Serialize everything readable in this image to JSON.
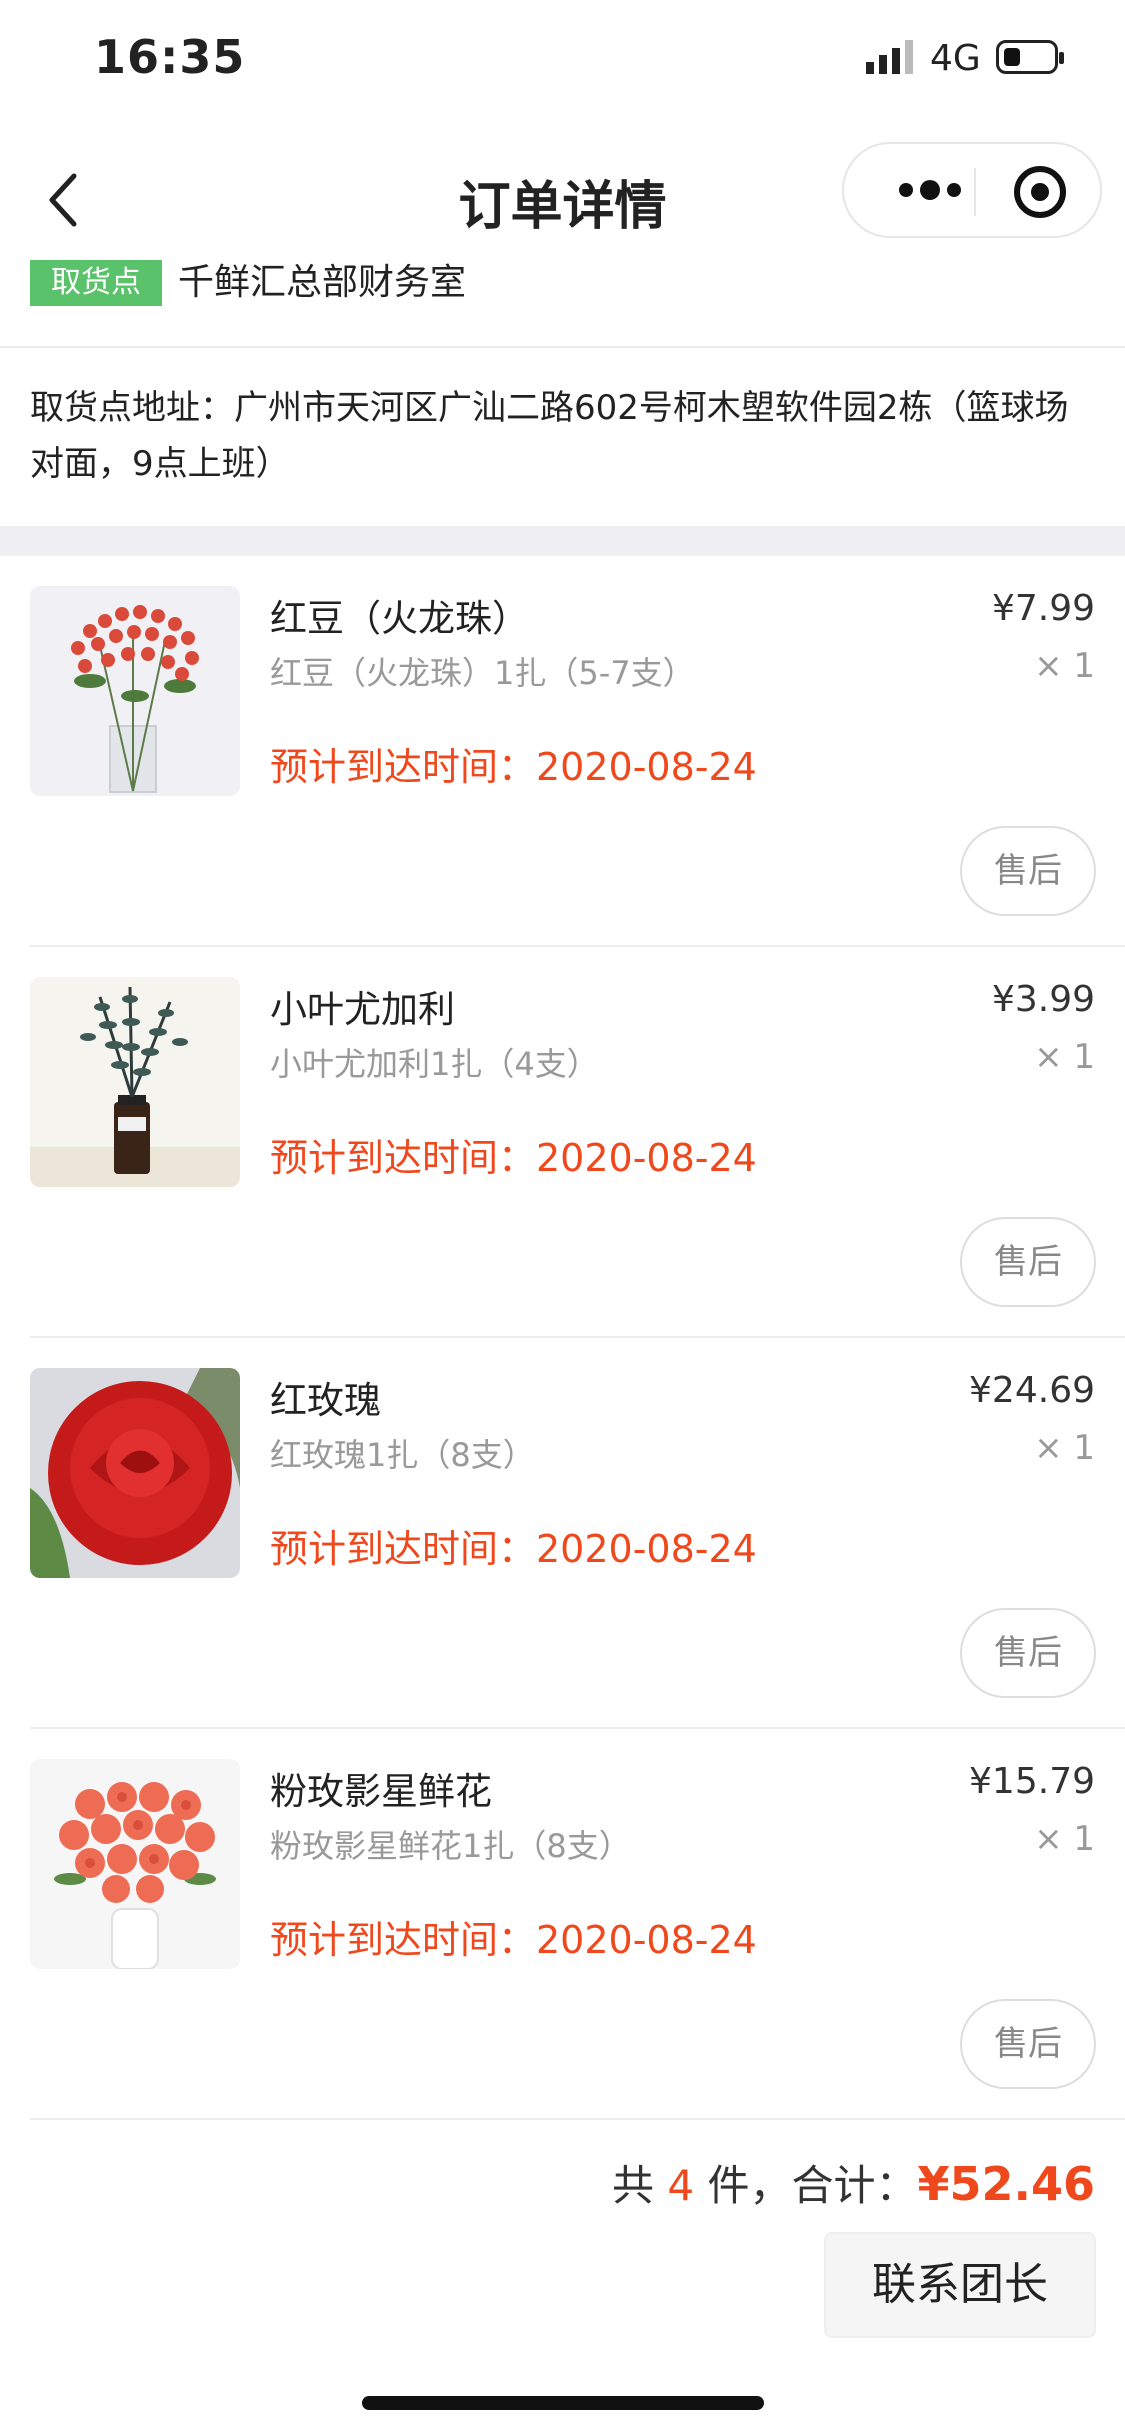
{
  "status_bar": {
    "time": "16:35",
    "network": "4G",
    "battery_level": 0.35
  },
  "nav": {
    "title": "订单详情",
    "icons": [
      "back-icon",
      "more-icon",
      "target-icon"
    ]
  },
  "pickup": {
    "tag": "取货点",
    "name": "千鲜汇总部财务室",
    "address": "取货点地址：广州市天河区广汕二路602号柯木塱软件园2栋（篮球场对面，9点上班）"
  },
  "items": [
    {
      "name": "红豆（火龙珠）",
      "spec": "红豆（火龙珠）1扎（5-7支）",
      "eta": "预计到达时间：2020-08-24",
      "price": "¥7.99",
      "qty": "× 1",
      "aftersale": "售后"
    },
    {
      "name": "小叶尤加利",
      "spec": "小叶尤加利1扎（4支）",
      "eta": "预计到达时间：2020-08-24",
      "price": "¥3.99",
      "qty": "× 1",
      "aftersale": "售后"
    },
    {
      "name": "红玫瑰",
      "spec": "红玫瑰1扎（8支）",
      "eta": "预计到达时间：2020-08-24",
      "price": "¥24.69",
      "qty": "× 1",
      "aftersale": "售后"
    },
    {
      "name": "粉玫影星鲜花",
      "spec": "粉玫影星鲜花1扎（8支）",
      "eta": "预计到达时间：2020-08-24",
      "price": "¥15.79",
      "qty": "× 1",
      "aftersale": "售后"
    }
  ],
  "summary": {
    "prefix": "共 ",
    "count": "4",
    "middle": " 件，合计：",
    "amount": "¥52.46"
  },
  "actions": {
    "contact": "联系团长"
  },
  "colors": {
    "accent": "#f0481d",
    "tag_green": "#5ac26a",
    "band_gray": "#efeff4"
  }
}
